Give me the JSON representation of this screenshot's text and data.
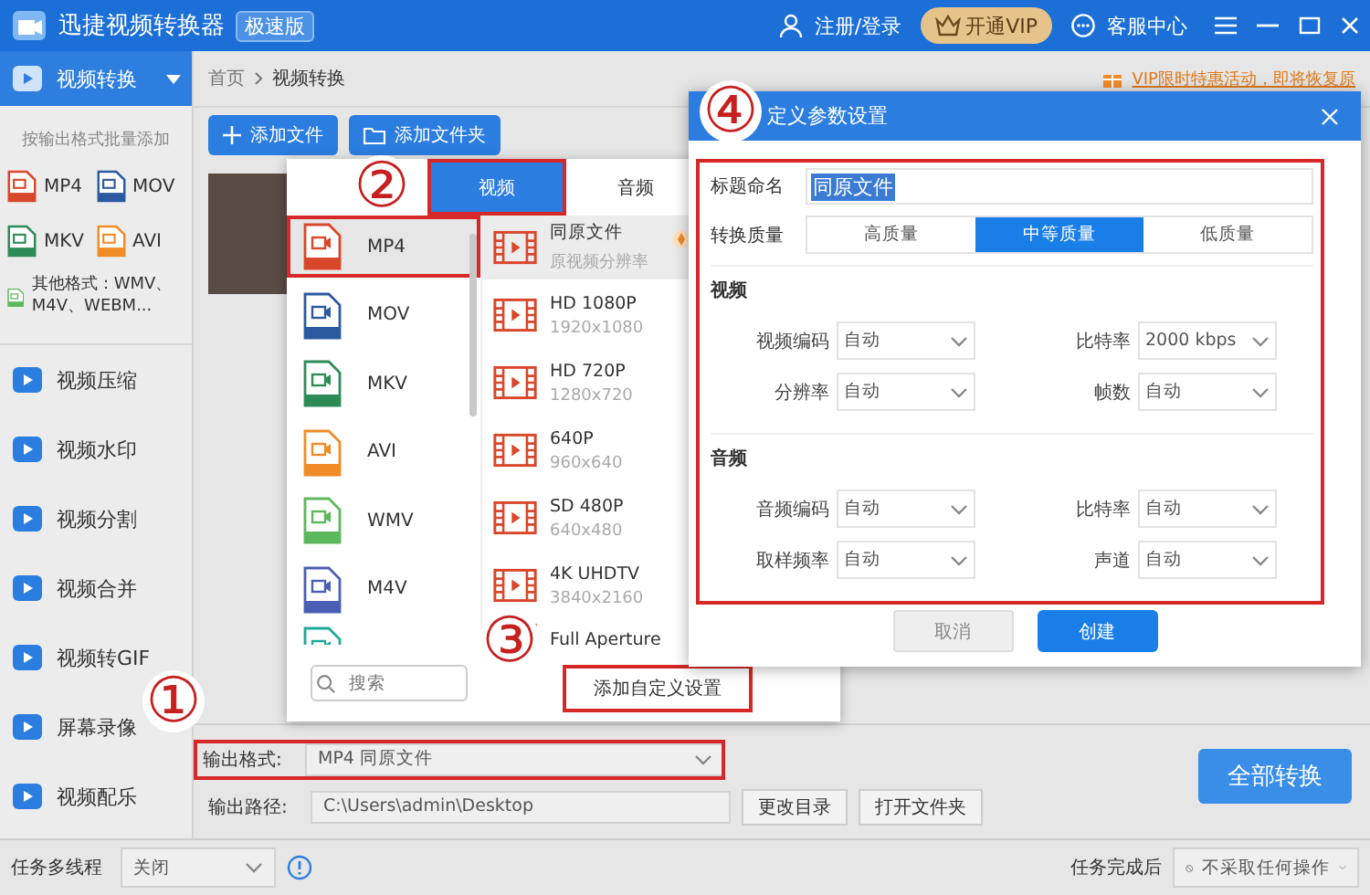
{
  "window": {
    "title": "迅捷视频转换器",
    "edition_badge": "极速版"
  },
  "header_actions": {
    "login": "注册/登录",
    "vip": "开通VIP",
    "support": "客服中心"
  },
  "sidebar": {
    "items": [
      {
        "label": "视频转换",
        "selected": true,
        "expanded": true
      },
      {
        "label": "视频压缩",
        "selected": false
      },
      {
        "label": "视频水印",
        "selected": false
      },
      {
        "label": "视频分割",
        "selected": false
      },
      {
        "label": "视频合并",
        "selected": false
      },
      {
        "label": "视频转GIF",
        "selected": false
      },
      {
        "label": "屏幕录像",
        "selected": false
      },
      {
        "label": "视频配乐",
        "selected": false
      }
    ],
    "batch_hint": "按输出格式批量添加",
    "batch_formats": [
      {
        "label": "MP4",
        "color": "#d9472b"
      },
      {
        "label": "MOV",
        "color": "#2c5aa0"
      },
      {
        "label": "MKV",
        "color": "#2e8b57"
      },
      {
        "label": "AVI",
        "color": "#f08c28"
      }
    ],
    "other_formats": "其他格式：WMV、M4V、WEBM..."
  },
  "breadcrumb": [
    "首页",
    "视频转换"
  ],
  "promo": "VIP限时特惠活动，即将恢复原",
  "toolbar": {
    "add_file": "添加文件",
    "add_folder": "添加文件夹"
  },
  "format_popup": {
    "tabs": [
      {
        "label": "视频",
        "selected": true,
        "callout": "②"
      },
      {
        "label": "音频",
        "selected": false
      }
    ],
    "formats": [
      {
        "label": "MP4",
        "color": "#d9472b",
        "selected": true,
        "highlighted": true
      },
      {
        "label": "MOV",
        "color": "#2c5aa0",
        "selected": false
      },
      {
        "label": "MKV",
        "color": "#2e8b57",
        "selected": false
      },
      {
        "label": "AVI",
        "color": "#f08c28",
        "selected": false
      },
      {
        "label": "WMV",
        "color": "#5cb85c",
        "selected": false
      },
      {
        "label": "M4V",
        "color": "#4a5fb5",
        "selected": false
      }
    ],
    "presets": [
      {
        "title": "同原文件",
        "detail": "原视频分辨率",
        "selected": true,
        "vip": true
      },
      {
        "title": "HD 1080P",
        "detail": "1920x1080",
        "selected": false,
        "vip": false
      },
      {
        "title": "HD 720P",
        "detail": "1280x720",
        "selected": false,
        "vip": false
      },
      {
        "title": "640P",
        "detail": "960x640",
        "selected": false,
        "vip": false
      },
      {
        "title": "SD 480P",
        "detail": "640x480",
        "selected": false,
        "vip": false
      },
      {
        "title": "4K UHDTV",
        "detail": "3840x2160",
        "selected": false,
        "vip": false
      },
      {
        "title": "Full Aperture",
        "selected": false,
        "vip": false
      }
    ],
    "search": {
      "placeholder": "搜索"
    },
    "add_custom": {
      "label": "添加自定义设置",
      "callout": "③"
    }
  },
  "output": {
    "format_label": "输出格式:",
    "format_value": "MP4  同原文件",
    "callout": "①",
    "path_label": "输出路径:",
    "path_value": "C:\\Users\\admin\\Desktop",
    "change_dir": "更改目录",
    "open_folder": "打开文件夹",
    "convert_all": "全部转换"
  },
  "status_bar": {
    "threads_label": "任务多线程",
    "threads_value": "关闭",
    "after_label": "任务完成后",
    "after_value": "不采取任何操作"
  },
  "dialog": {
    "title": "定义参数设置",
    "callout": "④",
    "name_label": "标题命名",
    "name_value": "同原文件",
    "quality_label": "转换质量",
    "quality": [
      {
        "label": "高质量",
        "selected": false
      },
      {
        "label": "中等质量",
        "selected": true
      },
      {
        "label": "低质量",
        "selected": false
      }
    ],
    "sections": [
      {
        "title": "视频",
        "fields": [
          {
            "label": "视频编码",
            "value": "自动"
          },
          {
            "label": "比特率",
            "value": "2000 kbps"
          },
          {
            "label": "分辨率",
            "value": "自动"
          },
          {
            "label": "帧数",
            "value": "自动"
          }
        ]
      },
      {
        "title": "音频",
        "fields": [
          {
            "label": "音频编码",
            "value": "自动"
          },
          {
            "label": "比特率",
            "value": "自动"
          },
          {
            "label": "取样频率",
            "value": "自动"
          },
          {
            "label": "声道",
            "value": "自动"
          }
        ]
      }
    ],
    "cancel": "取消",
    "create": "创建"
  }
}
